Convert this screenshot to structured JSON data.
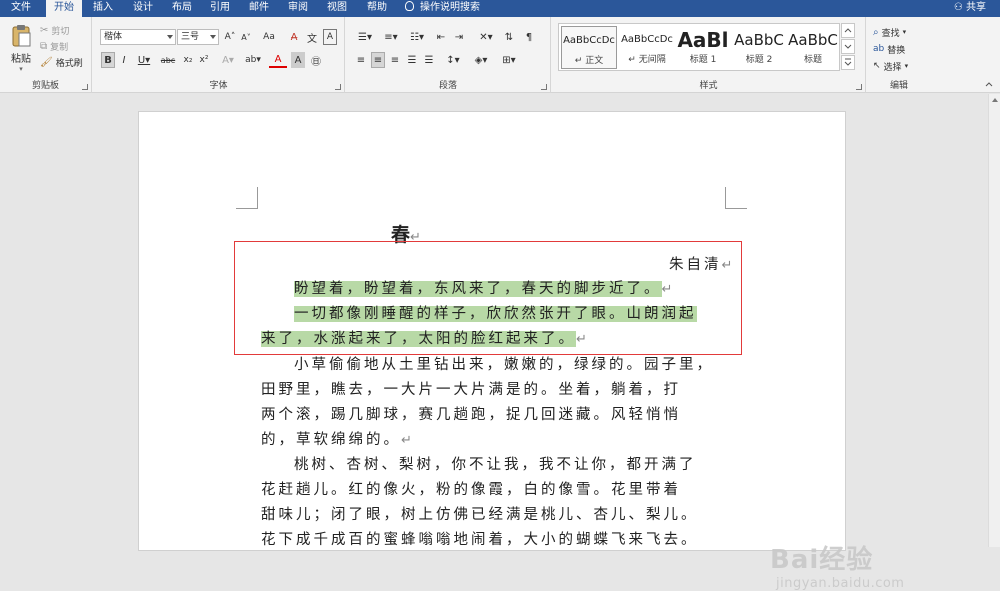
{
  "tabs": [
    "文件",
    "开始",
    "插入",
    "设计",
    "布局",
    "引用",
    "邮件",
    "审阅",
    "视图",
    "帮助"
  ],
  "active_tab": "开始",
  "tell_me": "操作说明搜索",
  "share": "共享",
  "clipboard": {
    "paste": "粘贴",
    "cut": "剪切",
    "copy": "复制",
    "format_painter": "格式刷",
    "label": "剪贴板"
  },
  "font": {
    "name": "楷体",
    "size": "三号",
    "grow": "A˄",
    "shrink": "A˅",
    "case": "Aa",
    "label": "字体"
  },
  "paragraph": {
    "label": "段落"
  },
  "styles": {
    "label": "样式",
    "items": [
      {
        "preview": "AaBbCcDc",
        "name": "↵ 正文"
      },
      {
        "preview": "AaBbCcDc",
        "name": "↵ 无间隔"
      },
      {
        "preview": "AaBl",
        "name": "标题 1"
      },
      {
        "preview": "AaBbC",
        "name": "标题 2"
      },
      {
        "preview": "AaBbC",
        "name": "标题"
      }
    ]
  },
  "editing": {
    "find": "查找",
    "replace": "替换",
    "select": "选择",
    "label": "编辑"
  },
  "document": {
    "title": "春",
    "author": "朱自清",
    "para_mark": "↵",
    "lines": [
      "盼望着，盼望着，东风来了，春天的脚步近了。",
      "一切都像刚睡醒的样子，欣欣然张开了眼。山朗润起",
      "来了，水涨起来了，太阳的脸红起来了。",
      "小草偷偷地从土里钻出来，嫩嫩的，绿绿的。园子里，",
      "田野里，瞧去，一大片一大片满是的。坐着，躺着，打",
      "两个滚，踢几脚球，赛几趟跑，捉几回迷藏。风轻悄悄",
      "的，草软绵绵的。",
      "桃树、杏树、梨树，你不让我，我不让你，都开满了",
      "花赶趟儿。红的像火，粉的像霞，白的像雪。花里带着",
      "甜味儿；闭了眼，树上仿佛已经满是桃儿、杏儿、梨儿。",
      "花下成千成百的蜜蜂嗡嗡地闹着，大小的蝴蝶飞来飞去。"
    ]
  },
  "watermark": {
    "brand": "Bai经验",
    "url": "jingyan.baidu.com"
  }
}
